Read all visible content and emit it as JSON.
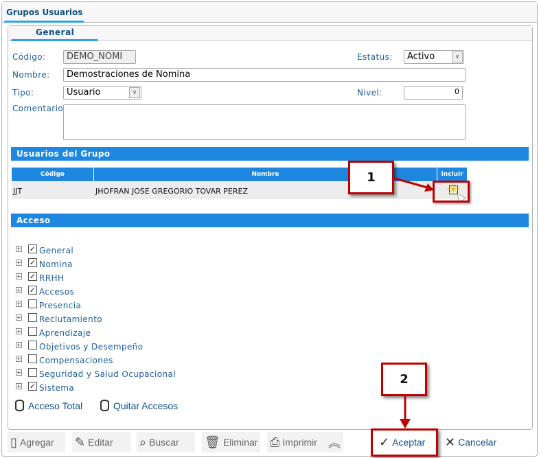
{
  "window": {
    "tab": "Grupos Usuarios",
    "subtab": "General"
  },
  "form": {
    "codigo_label": "Código:",
    "codigo": "DEMO_NOMI",
    "nombre_label": "Nombre:",
    "nombre": "Demostraciones de Nomina",
    "tipo_label": "Tipo:",
    "tipo": "Usuario",
    "comentario_label": "Comentario:",
    "comentario": "",
    "estatus_label": "Estatus:",
    "estatus": "Activo",
    "nivel_label": "Nivel:",
    "nivel": "0"
  },
  "usuarios": {
    "title": "Usuarios del Grupo",
    "columns": [
      "Código",
      "Nombre",
      "Incluir"
    ],
    "rows": [
      {
        "codigo": "JJT",
        "nombre": "JHOFRAN JOSE GREGORIO TOVAR PEREZ",
        "incluir": false
      }
    ]
  },
  "acceso": {
    "title": "Acceso",
    "items": [
      {
        "label": "General",
        "checked": true
      },
      {
        "label": "Nomina",
        "checked": true
      },
      {
        "label": "RRHH",
        "checked": true
      },
      {
        "label": "Accesos",
        "checked": true
      },
      {
        "label": "Presencia",
        "checked": false
      },
      {
        "label": "Reclutamiento",
        "checked": false
      },
      {
        "label": "Aprendizaje",
        "checked": false
      },
      {
        "label": "Objetivos y Desempeño",
        "checked": false
      },
      {
        "label": "Compensaciones",
        "checked": false
      },
      {
        "label": "Seguridad y Salud Ocupacional",
        "checked": false
      },
      {
        "label": "Sistema",
        "checked": true
      }
    ],
    "acceso_total": "Acceso Total",
    "quitar_accesos": "Quitar Accesos"
  },
  "toolbar": {
    "agregar": "Agregar",
    "editar": "Editar",
    "buscar": "Buscar",
    "eliminar": "Eliminar",
    "imprimir": "Imprimir",
    "aceptar": "Aceptar",
    "cancelar": "Cancelar"
  },
  "annotations": {
    "step1": "1",
    "step2": "2"
  },
  "colors": {
    "accent": "#1e88e0",
    "annotation": "#c00000"
  }
}
